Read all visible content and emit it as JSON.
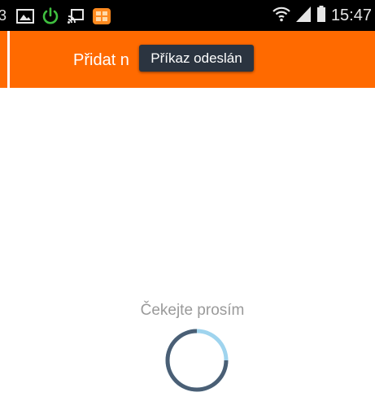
{
  "left_strip": {
    "digit": "3"
  },
  "status_bar": {
    "left_icons": [
      "gallery-icon",
      "power-icon",
      "cast-icon",
      "app-notification-icon"
    ],
    "right_icons": [
      "wifi-icon",
      "signal-icon",
      "battery-icon"
    ],
    "time": "15:47"
  },
  "action_bar": {
    "title": "Přidat n"
  },
  "toast": {
    "message": "Příkaz odeslán"
  },
  "loading": {
    "label": "Čekejte prosím"
  },
  "colors": {
    "action_bar": "#ff6a00",
    "status_bar": "#000000",
    "toast_bg": "#2b3440",
    "spinner_dark": "#4a5f75",
    "spinner_light": "#9fd4ee"
  }
}
